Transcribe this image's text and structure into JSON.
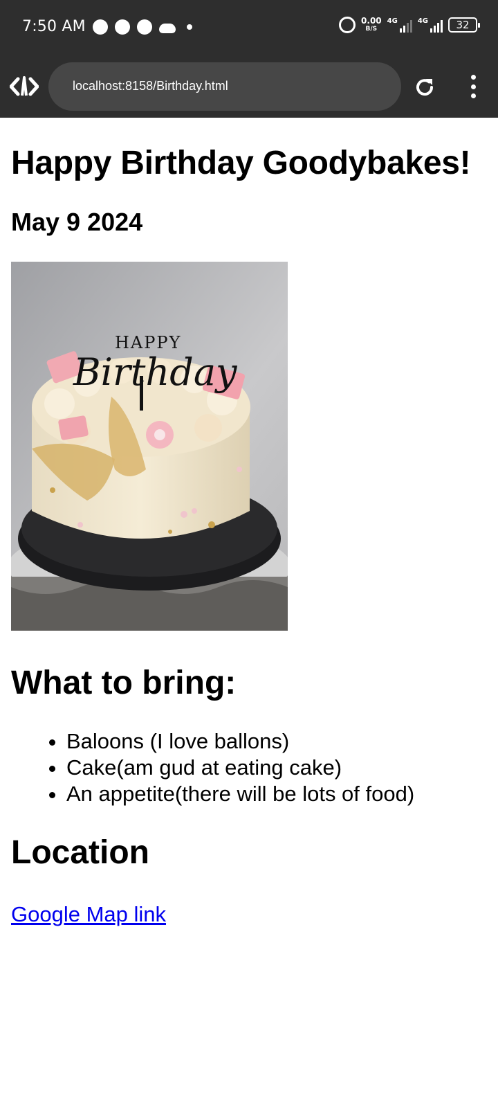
{
  "status_bar": {
    "time": "7:50 AM",
    "net_speed_value": "0.00",
    "net_speed_unit": "B/S",
    "signal1_label": "4G",
    "signal2_label": "4G",
    "battery": "32",
    "icons": [
      "sync-icon",
      "location-icon",
      "telegram-icon",
      "cloud-icon",
      "dot-icon",
      "alarm-icon"
    ]
  },
  "browser": {
    "url": "localhost:8158/Birthday.html",
    "icons": [
      "brand-icon",
      "reload-icon",
      "more-menu-icon"
    ]
  },
  "page": {
    "title": "Happy Birthday Goodybakes!",
    "date": "May 9 2024",
    "image_topper_text": "HAPPY Birthday",
    "bring_heading": "What to bring:",
    "bring_items": [
      "Baloons (I love ballons)",
      "Cake(am gud at eating cake)",
      "An appetite(there will be lots of food)"
    ],
    "location_heading": "Location",
    "map_link": "Google Map link"
  },
  "colors": {
    "chrome_bg": "#2e2e2e",
    "url_pill": "#474747",
    "link": "#0000ee"
  }
}
